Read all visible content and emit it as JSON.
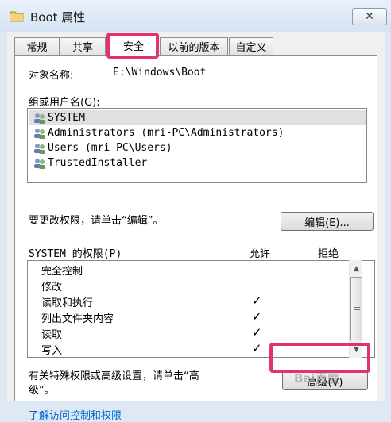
{
  "window": {
    "title": "Boot 属性",
    "close_glyph": "✕"
  },
  "tabs": [
    {
      "label": "常规"
    },
    {
      "label": "共享"
    },
    {
      "label": "安全"
    },
    {
      "label": "以前的版本"
    },
    {
      "label": "自定义"
    }
  ],
  "security": {
    "object_name_label": "对象名称:",
    "object_name_value": "E:\\Windows\\Boot",
    "group_label": "组或用户名(G):",
    "users": [
      {
        "name": "SYSTEM"
      },
      {
        "name": "Administrators (mri-PC\\Administrators)"
      },
      {
        "name": "Users (mri-PC\\Users)"
      },
      {
        "name": "TrustedInstaller"
      }
    ],
    "change_hint": "要更改权限，请单击“编辑”。",
    "edit_button": "编辑(E)...",
    "perm_header": "SYSTEM 的权限(P)",
    "allow_header": "允许",
    "deny_header": "拒绝",
    "permissions": [
      {
        "name": "完全控制",
        "allow": "",
        "deny": ""
      },
      {
        "name": "修改",
        "allow": "",
        "deny": ""
      },
      {
        "name": "读取和执行",
        "allow": "✓",
        "deny": ""
      },
      {
        "name": "列出文件夹内容",
        "allow": "✓",
        "deny": ""
      },
      {
        "name": "读取",
        "allow": "✓",
        "deny": ""
      },
      {
        "name": "写入",
        "allow": "✓",
        "deny": ""
      }
    ],
    "advanced_hint_line1": "有关特殊权限或高级设置，请单击“高",
    "advanced_hint_line2": "级”。",
    "advanced_button": "高级(V)",
    "help_link": "了解访问控制和权限"
  },
  "scrollbar": {
    "up": "▲",
    "down": "▼"
  },
  "watermark": "Bai百度"
}
